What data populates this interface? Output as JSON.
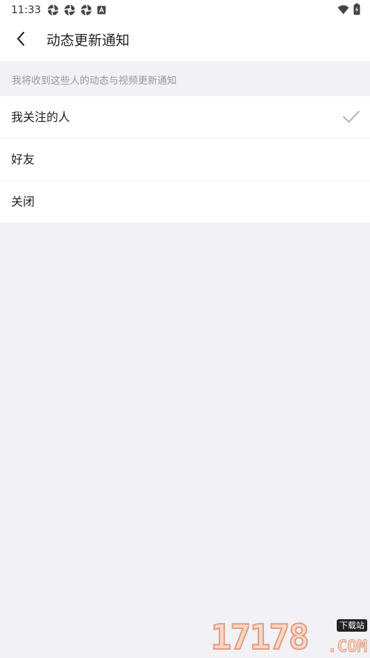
{
  "status_bar": {
    "time": "11:33",
    "notification_icons": [
      "aperture-icon",
      "aperture-icon",
      "aperture-icon",
      "a-box-icon"
    ],
    "right_icons": [
      "wifi-icon",
      "battery-charging-icon"
    ]
  },
  "header": {
    "back_icon": "chevron-left-icon",
    "title": "动态更新通知"
  },
  "caption": "我将收到这些人的动态与视频更新通知",
  "options": [
    {
      "label": "我关注的人",
      "selected": true
    },
    {
      "label": "好友",
      "selected": false
    },
    {
      "label": "关闭",
      "selected": false
    }
  ],
  "watermark": {
    "digits": "17178",
    "badge": "下载站",
    "domain": ".COM"
  },
  "colors": {
    "background": "#f1f1f6",
    "surface": "#ffffff",
    "text_primary": "#222222",
    "text_secondary": "#999999",
    "check": "#b0b0b0"
  }
}
